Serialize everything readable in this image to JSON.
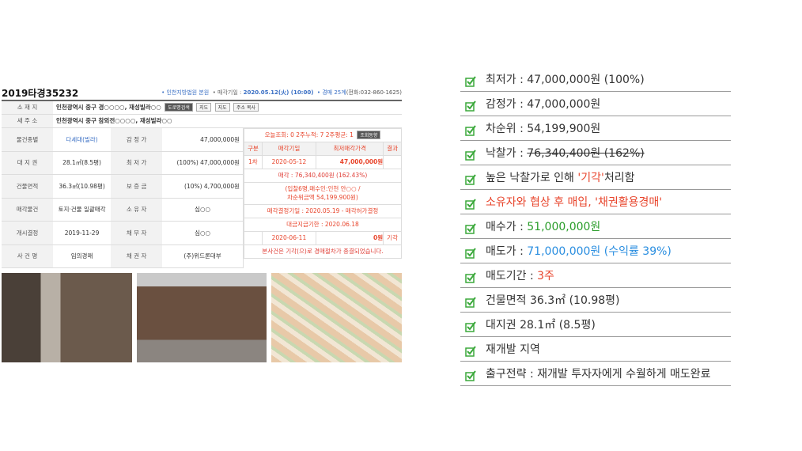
{
  "case": {
    "number": "2019타경35232",
    "court": "• 인천지방법원 본원",
    "sale_date_label": "• 매각기일 : ",
    "sale_date": "2020.05.12(火) (10:00)",
    "auction_no": "• 경매 25계",
    "phone": "(전화:032-860-1625)"
  },
  "address": {
    "label": "소 재 지",
    "value": "인천광역시 중구 경○○○○, 재성빌라○○",
    "buttons": [
      "도로명검색",
      "지도",
      "지도",
      "주소 복사"
    ],
    "new_label": "새 주 소",
    "new_value": "인천광역시 중구 참외전○○○○, 재성빌라○○"
  },
  "details": [
    {
      "l1": "물건종별",
      "v1": "다세대(빌라)",
      "l2": "감 정 가",
      "v2": "47,000,000원"
    },
    {
      "l1": "대 지 권",
      "v1": "28.1㎡(8.5평)",
      "l2": "최 저 가",
      "v2": "(100%) 47,000,000원"
    },
    {
      "l1": "건물면적",
      "v1": "36.3㎡(10.98평)",
      "l2": "보 증 금",
      "v2": "(10%) 4,700,000원"
    },
    {
      "l1": "매각물건",
      "v1": "토지·건물 일괄매각",
      "l2": "소 유 자",
      "v2": "심○○"
    },
    {
      "l1": "개시결정",
      "v1": "2019-11-29",
      "l2": "채 무 자",
      "v2": "심○○"
    },
    {
      "l1": "사 건 명",
      "v1": "임의경매",
      "l2": "채 권 자",
      "v2": "(주)위드론대부"
    }
  ],
  "history": {
    "views": "오늘조회: 0  2주누적: 7  2주평균: 1",
    "views_btn": "조회동향",
    "headers": [
      "구분",
      "매각기일",
      "최저매각가격",
      "결과"
    ],
    "row1": [
      "1차",
      "2020-05-12",
      "47,000,000원",
      ""
    ],
    "sold": "매각 : 76,340,400원  (162.43%)",
    "bidders": "(입찰6명,매수인:인천 안○○ /",
    "second": "차순위금액 54,199,900원)",
    "decision": "매각결정기일 : 2020.05.19 - 매각허가결정",
    "payment": "대금지급기한 : 2020.06.18",
    "row2": [
      "",
      "2020-06-11",
      "0원",
      "기각"
    ],
    "note": "본사건은 기각(으)로 경매절차가 종결되었습니다."
  },
  "checklist": [
    {
      "parts": [
        {
          "t": "최저가 : 47,000,000원 (100%)"
        }
      ]
    },
    {
      "parts": [
        {
          "t": "감정가 : 47,000,000원"
        }
      ]
    },
    {
      "parts": [
        {
          "t": "차순위 : 54,199,900원"
        }
      ]
    },
    {
      "parts": [
        {
          "t": "낙찰가 : "
        },
        {
          "t": "76,340,400원 (162%)",
          "c": "strike"
        }
      ]
    },
    {
      "parts": [
        {
          "t": "높은 낙찰가로 인해 "
        },
        {
          "t": "'기각'",
          "c": "r"
        },
        {
          "t": "처리함"
        }
      ]
    },
    {
      "parts": [
        {
          "t": "소유자와 협상 후 매입, '채권활용경매'",
          "c": "r"
        }
      ]
    },
    {
      "parts": [
        {
          "t": "매수가 : "
        },
        {
          "t": "51,000,000원",
          "c": "g"
        }
      ]
    },
    {
      "parts": [
        {
          "t": "매도가 : "
        },
        {
          "t": "71,000,000원 (수익률 39%)",
          "c": "b"
        }
      ]
    },
    {
      "parts": [
        {
          "t": "매도기간 : "
        },
        {
          "t": "3주",
          "c": "r"
        }
      ]
    },
    {
      "parts": [
        {
          "t": "건물면적 36.3㎡ (10.98평)"
        }
      ]
    },
    {
      "parts": [
        {
          "t": "대지권 28.1㎡ (8.5평)"
        }
      ]
    },
    {
      "parts": [
        {
          "t": "재개발 지역"
        }
      ]
    },
    {
      "parts": [
        {
          "t": "출구전략 : 재개발 투자자에게 수월하게 매도완료"
        }
      ]
    }
  ]
}
